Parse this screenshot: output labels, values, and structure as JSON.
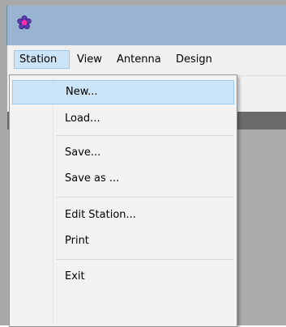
{
  "menubar": {
    "items": [
      {
        "label": "Station"
      },
      {
        "label": "View"
      },
      {
        "label": "Antenna"
      },
      {
        "label": "Design"
      }
    ]
  },
  "station_menu": {
    "items": [
      {
        "label": "New..."
      },
      {
        "label": "Load..."
      },
      {
        "label": "Save..."
      },
      {
        "label": "Save as ..."
      },
      {
        "label": "Edit Station..."
      },
      {
        "label": "Print"
      },
      {
        "label": "Exit"
      }
    ]
  },
  "colors": {
    "titlebar": "#99b4d1",
    "highlight": "#cce4f7",
    "icon_petals": "#5b3ab0",
    "icon_center": "#ff2fa8"
  }
}
